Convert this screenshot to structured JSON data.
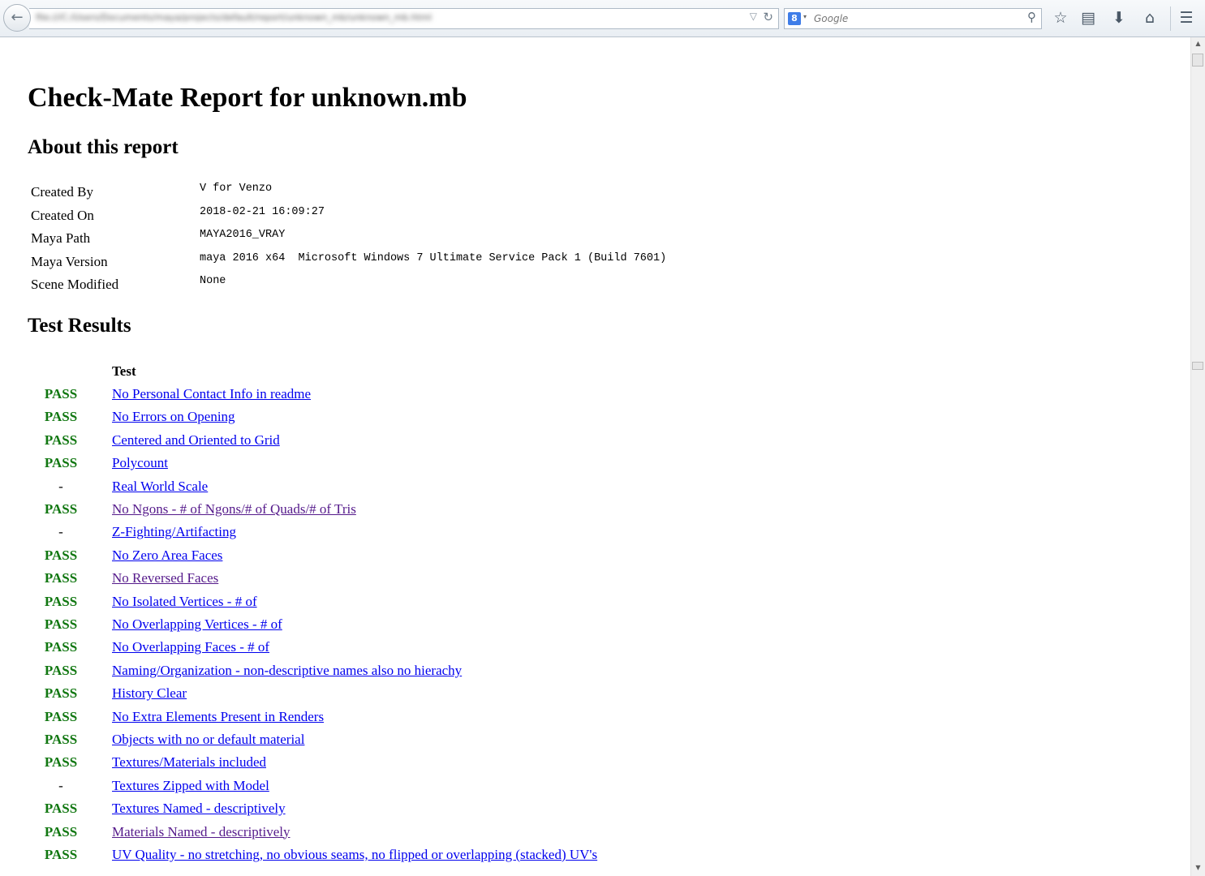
{
  "browser": {
    "url": "file:///C:/Users/Documents/maya/projects/default/report/unknown_mb/unknown_mb.html",
    "search_placeholder": "Google",
    "search_engine_icon": "8",
    "icons": {
      "back": "←",
      "url_dropdown": "▽",
      "reload": "↻",
      "engine_dropdown": "▾",
      "search_go": "⚲",
      "bookmark_star": "☆",
      "reading_list": "▤",
      "downloads": "⬇",
      "home": "⌂",
      "menu": "☰"
    }
  },
  "scrollbar": {
    "up_arrow": "▲",
    "down_arrow": "▼"
  },
  "report": {
    "title": "Check-Mate Report for unknown.mb",
    "about_heading": "About this report",
    "about": [
      {
        "label": "Created By",
        "value": "V for Venzo"
      },
      {
        "label": "Created On",
        "value": "2018-02-21 16:09:27"
      },
      {
        "label": "Maya Path",
        "value": "MAYA2016_VRAY"
      },
      {
        "label": "Maya Version",
        "value": "maya 2016 x64  Microsoft Windows 7 Ultimate Service Pack 1 (Build 7601)"
      },
      {
        "label": "Scene Modified",
        "value": "None"
      }
    ],
    "results_heading": "Test Results",
    "test_column_header": "Test",
    "results": [
      {
        "status": "PASS",
        "test": "No Personal Contact Info in readme",
        "visited": false
      },
      {
        "status": "PASS",
        "test": "No Errors on Opening",
        "visited": false
      },
      {
        "status": "PASS",
        "test": "Centered and Oriented to Grid",
        "visited": false
      },
      {
        "status": "PASS",
        "test": "Polycount",
        "visited": false
      },
      {
        "status": "-",
        "test": "Real World Scale",
        "visited": false
      },
      {
        "status": "PASS",
        "test": "No Ngons - # of Ngons/# of Quads/# of Tris",
        "visited": true
      },
      {
        "status": "-",
        "test": "Z-Fighting/Artifacting",
        "visited": false
      },
      {
        "status": "PASS",
        "test": "No Zero Area Faces",
        "visited": false
      },
      {
        "status": "PASS",
        "test": "No Reversed Faces",
        "visited": true
      },
      {
        "status": "PASS",
        "test": "No Isolated Vertices - # of",
        "visited": false
      },
      {
        "status": "PASS",
        "test": "No Overlapping Vertices - # of",
        "visited": false
      },
      {
        "status": "PASS",
        "test": "No Overlapping Faces - # of",
        "visited": false
      },
      {
        "status": "PASS",
        "test": "Naming/Organization - non-descriptive names also no hierachy",
        "visited": false
      },
      {
        "status": "PASS",
        "test": "History Clear",
        "visited": false
      },
      {
        "status": "PASS",
        "test": "No Extra Elements Present in Renders",
        "visited": false
      },
      {
        "status": "PASS",
        "test": "Objects with no or default material",
        "visited": false
      },
      {
        "status": "PASS",
        "test": "Textures/Materials included",
        "visited": false
      },
      {
        "status": "-",
        "test": "Textures Zipped with Model",
        "visited": false
      },
      {
        "status": "PASS",
        "test": "Textures Named - descriptively",
        "visited": false
      },
      {
        "status": "PASS",
        "test": "Materials Named - descriptively",
        "visited": true
      },
      {
        "status": "PASS",
        "test": "UV Quality - no stretching, no obvious seams, no flipped or overlapping (stacked) UV's",
        "visited": false
      }
    ]
  }
}
